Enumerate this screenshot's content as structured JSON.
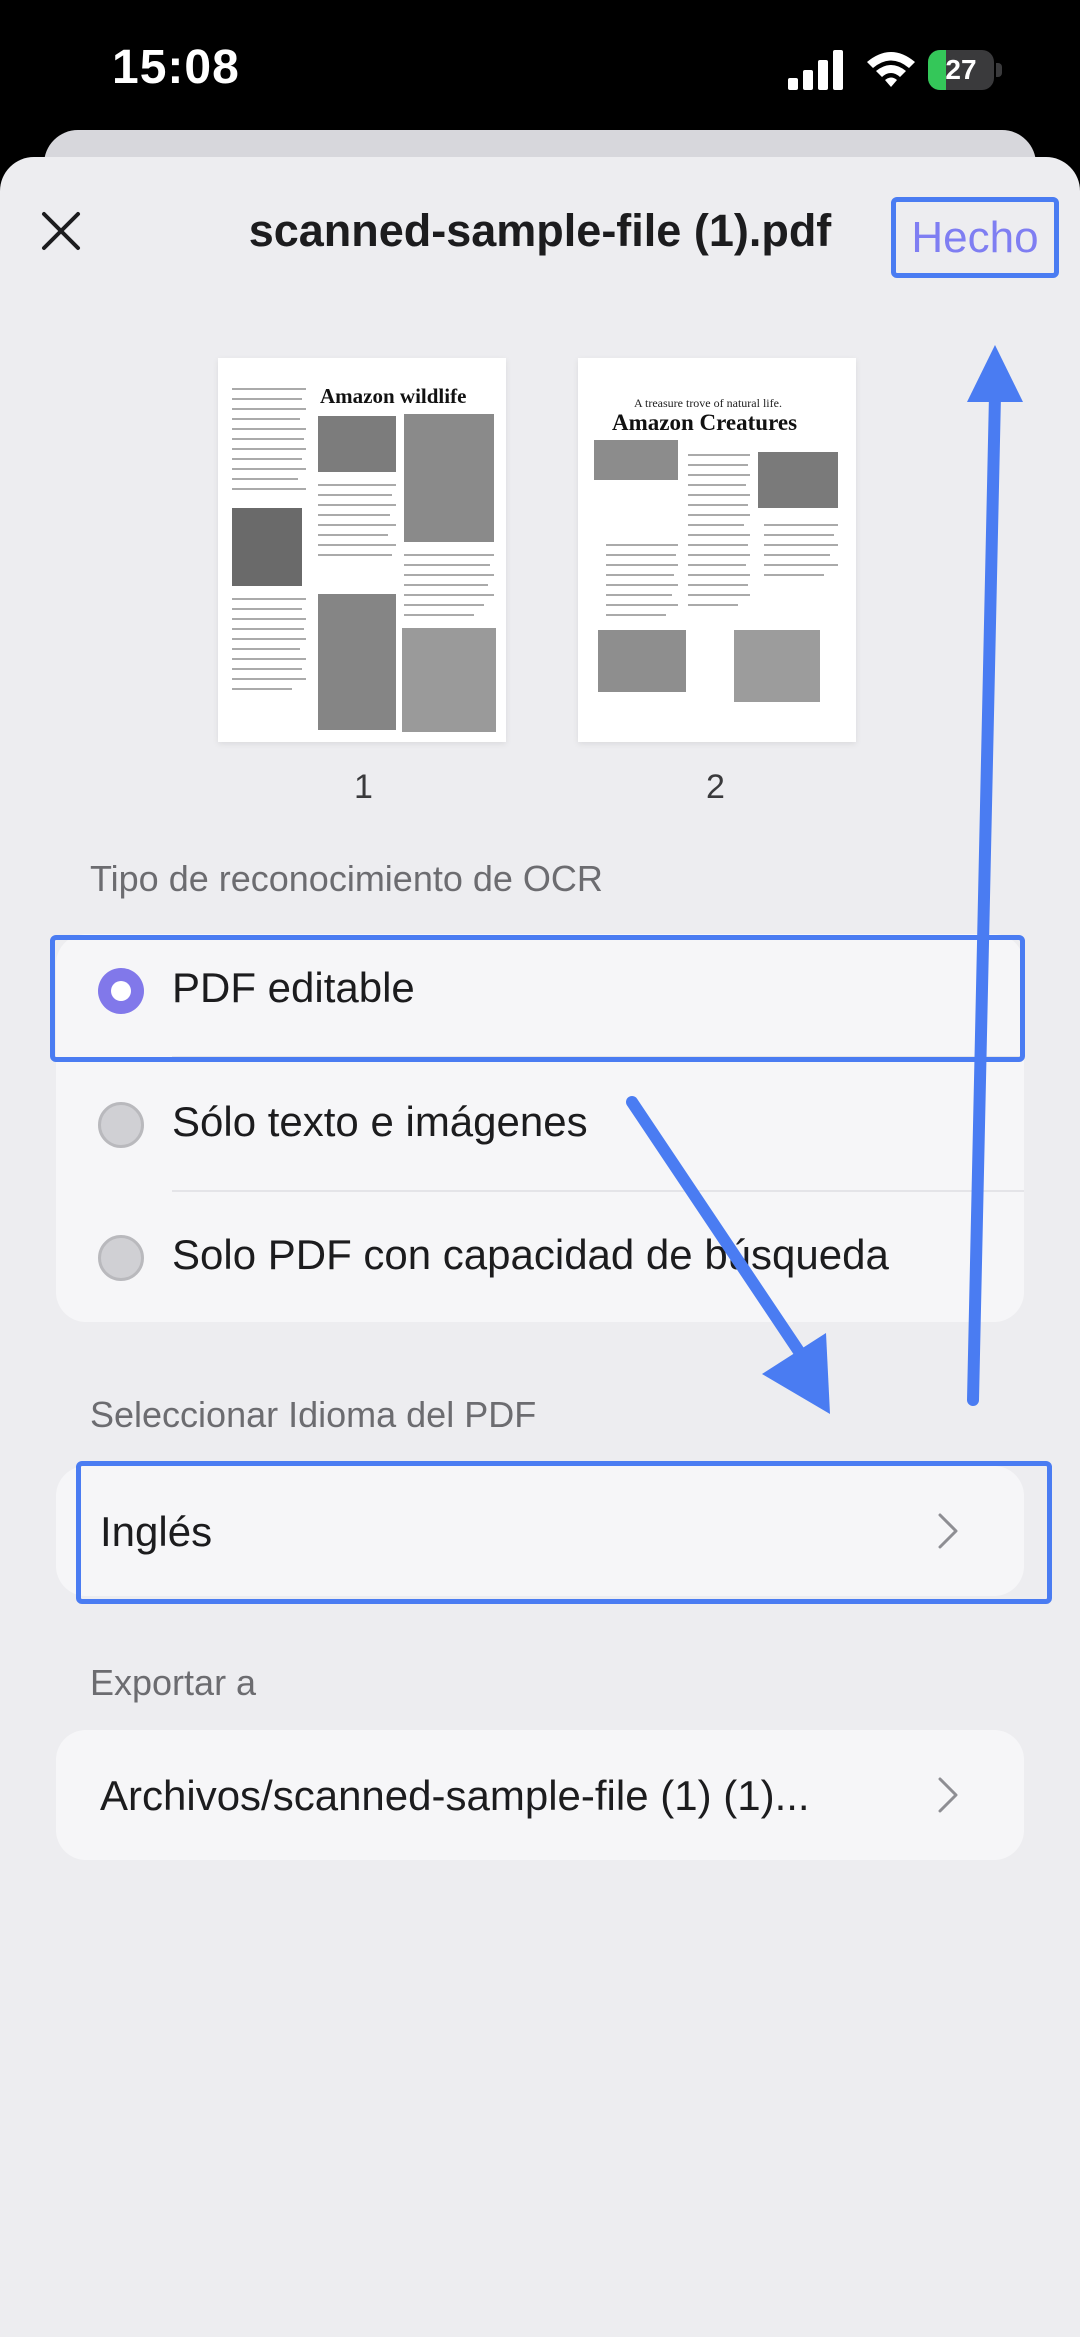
{
  "status_bar": {
    "time": "15:08",
    "battery_level": "27",
    "battery_fraction": 0.27,
    "icons": [
      "signal-icon",
      "wifi-icon",
      "battery-icon"
    ]
  },
  "header": {
    "title": "scanned-sample-file (1).pdf",
    "done_label": "Hecho",
    "close_icon": "close-icon"
  },
  "pages": [
    {
      "number": "1",
      "heading": "Amazon wildlife"
    },
    {
      "number": "2",
      "subheading": "A treasure trove of natural life.",
      "heading": "Amazon Creatures"
    }
  ],
  "ocr": {
    "section_label": "Tipo de reconocimiento de OCR",
    "options": [
      {
        "label": "PDF editable",
        "selected": true
      },
      {
        "label": "Sólo texto e imágenes",
        "selected": false
      },
      {
        "label": "Solo PDF con capacidad de búsqueda",
        "selected": false
      }
    ]
  },
  "language": {
    "section_label": "Seleccionar Idioma del PDF",
    "value": "Inglés"
  },
  "export": {
    "section_label": "Exportar a",
    "value": "Archivos/scanned-sample-file (1) (1)..."
  },
  "colors": {
    "accent": "#8178ea",
    "highlight": "#4a7cf2",
    "background": "#ededf0",
    "card": "#f6f6f8"
  }
}
